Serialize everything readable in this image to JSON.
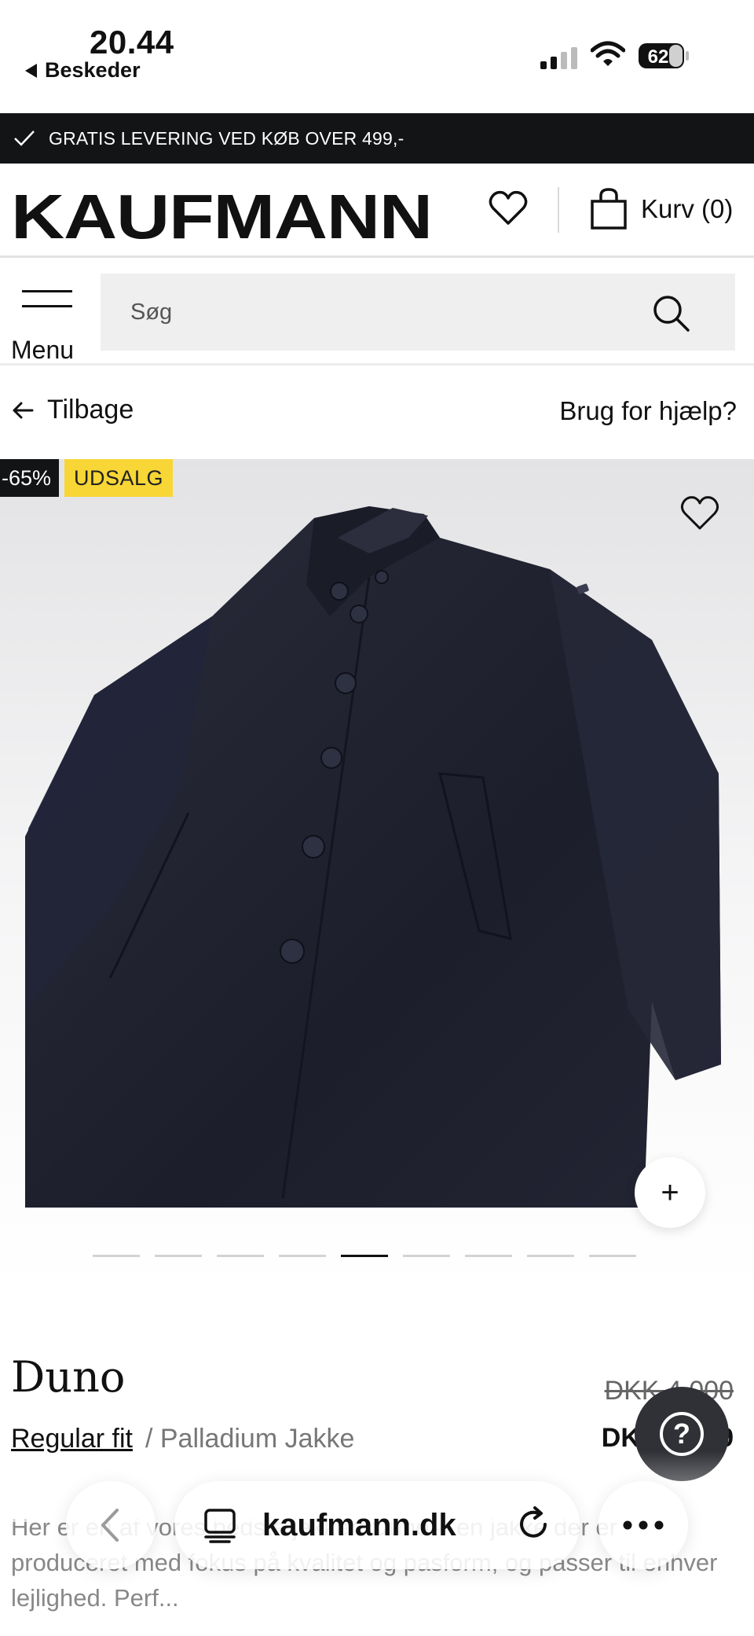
{
  "status_bar": {
    "time": "20.44",
    "back_app": "Beskeder",
    "battery": "62"
  },
  "promo": {
    "text": "GRATIS LEVERING VED KØB OVER 499,-"
  },
  "header": {
    "logo": "KAUFMANN",
    "cart_label": "Kurv (0)"
  },
  "nav": {
    "menu_label": "Menu",
    "search_placeholder": "Søg"
  },
  "page_nav": {
    "back_label": "Tilbage",
    "help_label": "Brug for hjælp?"
  },
  "product": {
    "discount_badge": "-65%",
    "sale_badge": "UDSALG",
    "name": "Duno",
    "fit": "Regular fit",
    "category": "/ Palladium Jakke",
    "price_old": "DKK 4.000",
    "price_new": "DKK 1.399",
    "description": "Her er en af vores bedste jakker: Duno – en jakke der er produceret med fokus på kvalitet og pasform, og passer til enhver lejlighed. Perf...",
    "image_count": 9,
    "active_image_index": 4
  },
  "browser": {
    "domain": "kaufmann.dk"
  },
  "colors": {
    "promo_bg": "#121416",
    "sale_badge_bg": "#f7d636",
    "accent": "#111111"
  }
}
